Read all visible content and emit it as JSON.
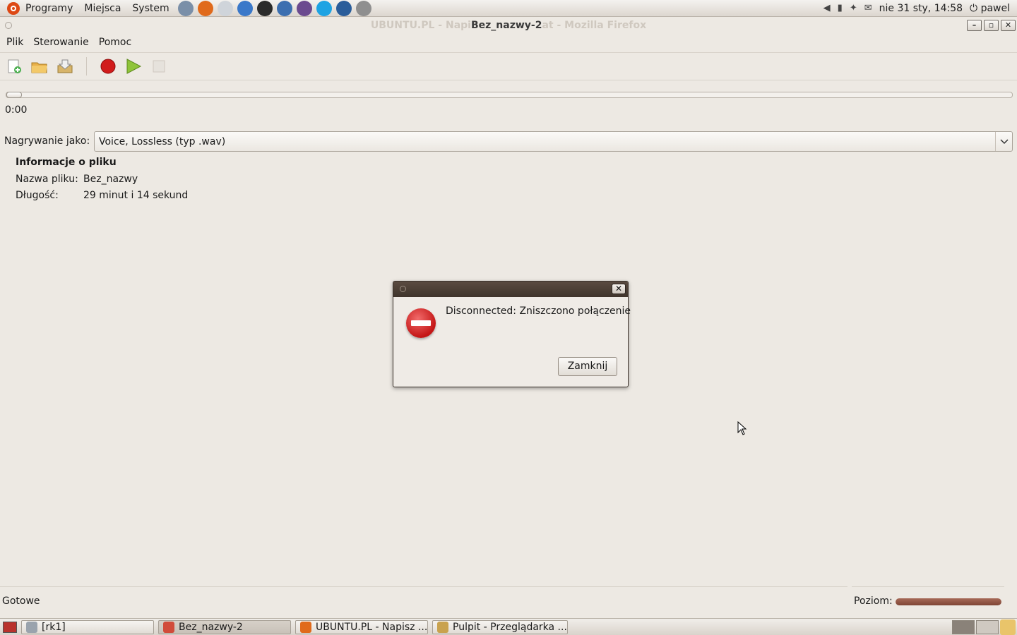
{
  "top_panel": {
    "menus": [
      "Programy",
      "Miejsca",
      "System"
    ],
    "launchers": [
      {
        "icon": "settings-icon",
        "color": "#7a8fa8"
      },
      {
        "icon": "firefox-icon",
        "color": "#e06a1b"
      },
      {
        "icon": "mail-icon",
        "color": "#cfd4da"
      },
      {
        "icon": "help-icon",
        "color": "#3a78c9"
      },
      {
        "icon": "terminal-icon",
        "color": "#2b2b2b"
      },
      {
        "icon": "thunderbird-icon",
        "color": "#3c6fb0"
      },
      {
        "icon": "pidgin-icon",
        "color": "#6b4a8f"
      },
      {
        "icon": "skype-icon",
        "color": "#1ea3e3"
      },
      {
        "icon": "network-icon",
        "color": "#2a5d9a"
      },
      {
        "icon": "screenshot-icon",
        "color": "#8f8f8f"
      }
    ],
    "clock": "nie 31 sty, 14:58",
    "user": "pawel"
  },
  "window": {
    "title_ghost_left": "UBUNTU.PL - Napi",
    "title": "Bez_nazwy-2",
    "title_ghost_right": "at - Mozilla Firefox"
  },
  "menubar": [
    "Plik",
    "Sterowanie",
    "Pomoc"
  ],
  "player": {
    "time": "0:00",
    "position_fraction": 0
  },
  "record": {
    "label": "Nagrywanie jako:",
    "selected": "Voice, Lossless (typ .wav)"
  },
  "file_info": {
    "heading": "Informacje o pliku",
    "name_label": "Nazwa pliku:",
    "name_value": "Bez_nazwy",
    "length_label": "Długość:",
    "length_value": "29 minut i 14 sekund"
  },
  "dialog": {
    "message": "Disconnected: Zniszczono połączenie",
    "button": "Zamknij"
  },
  "status": {
    "text": "Gotowe",
    "level_label": "Poziom:",
    "level_fraction": 1.0
  },
  "taskbar": {
    "tasks": [
      {
        "label": "[rk1]",
        "icon": "folder-icon",
        "color": "#9aa3ad",
        "width": 188
      },
      {
        "label": "Bez_nazwy-2",
        "icon": "sound-recorder-icon",
        "color": "#d14b3a",
        "width": 188
      },
      {
        "label": "UBUNTU.PL - Napisz ...",
        "icon": "firefox-icon",
        "color": "#e06a1b",
        "width": 188
      },
      {
        "label": "Pulpit - Przeglądarka ...",
        "icon": "file-manager-icon",
        "color": "#c9a24e",
        "width": 192
      }
    ]
  }
}
